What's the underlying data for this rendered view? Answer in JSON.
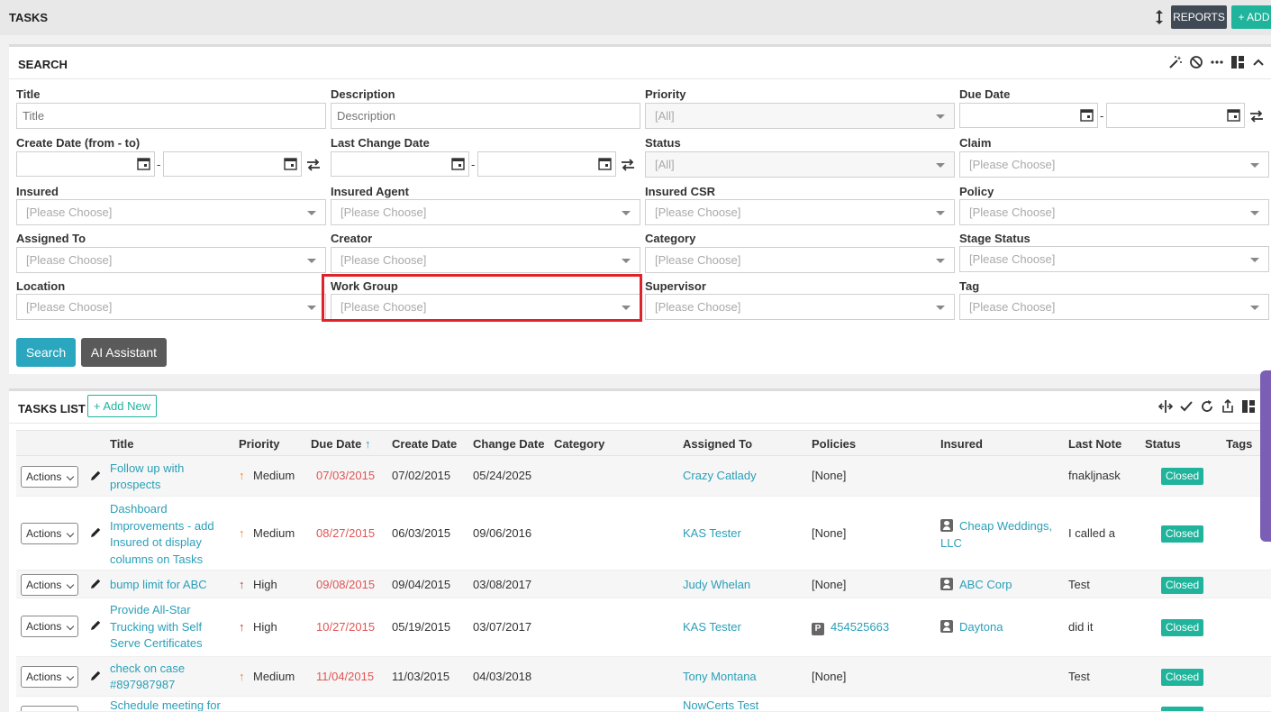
{
  "topbar": {
    "title": "TASKS",
    "reports_label": "REPORTS",
    "add_label": "+ ADD"
  },
  "search_panel": {
    "title": "SEARCH",
    "fields": {
      "title": {
        "label": "Title",
        "placeholder": "Title"
      },
      "description": {
        "label": "Description",
        "placeholder": "Description"
      },
      "priority": {
        "label": "Priority",
        "value": "[All]"
      },
      "due_date": {
        "label": "Due Date"
      },
      "create_date": {
        "label": "Create Date (from - to)"
      },
      "last_change_date": {
        "label": "Last Change Date"
      },
      "status": {
        "label": "Status",
        "value": "[All]"
      },
      "claim": {
        "label": "Claim",
        "value": "[Please Choose]"
      },
      "insured": {
        "label": "Insured",
        "value": "[Please Choose]"
      },
      "insured_agent": {
        "label": "Insured Agent",
        "value": "[Please Choose]"
      },
      "insured_csr": {
        "label": "Insured CSR",
        "value": "[Please Choose]"
      },
      "policy": {
        "label": "Policy",
        "value": "[Please Choose]"
      },
      "assigned_to": {
        "label": "Assigned To",
        "value": "[Please Choose]"
      },
      "creator": {
        "label": "Creator",
        "value": "[Please Choose]"
      },
      "category": {
        "label": "Category",
        "value": "[Please Choose]"
      },
      "stage_status": {
        "label": "Stage Status",
        "value": "[Please Choose]"
      },
      "location": {
        "label": "Location",
        "value": "[Please Choose]"
      },
      "work_group": {
        "label": "Work Group",
        "value": "[Please Choose]"
      },
      "supervisor": {
        "label": "Supervisor",
        "value": "[Please Choose]"
      },
      "tag": {
        "label": "Tag",
        "value": "[Please Choose]"
      }
    },
    "date_separator": "-",
    "search_label": "Search",
    "ai_label": "AI Assistant"
  },
  "tasks_list": {
    "title": "TASKS LIST",
    "add_new_label": "+ Add New",
    "columns": [
      "Title",
      "Priority",
      "Due Date",
      "Create Date",
      "Change Date",
      "Category",
      "Assigned To",
      "Policies",
      "Insured",
      "Last Note",
      "Status",
      "Tags"
    ],
    "sort_arrow": "↑",
    "actions_label": "Actions",
    "rows": [
      {
        "title": "Follow up with prospects",
        "priority": "Medium",
        "due": "07/03/2015",
        "created": "07/02/2015",
        "changed": "05/24/2025",
        "assigned": "Crazy Catlady",
        "policies": "[None]",
        "insured": "",
        "note": "fnakljnask",
        "status": "Closed"
      },
      {
        "title": "Dashboard Improvements - add Insured ot display columns on Tasks",
        "priority": "Medium",
        "due": "08/27/2015",
        "created": "06/03/2015",
        "changed": "09/06/2016",
        "assigned": "KAS Tester",
        "policies": "[None]",
        "insured": "Cheap Weddings, LLC",
        "note": "I called a",
        "status": "Closed"
      },
      {
        "title": "bump limit for ABC",
        "priority": "High",
        "due": "09/08/2015",
        "created": "09/04/2015",
        "changed": "03/08/2017",
        "assigned": "Judy Whelan",
        "policies": "[None]",
        "insured": "ABC Corp",
        "note": "Test",
        "status": "Closed"
      },
      {
        "title": "Provide All-Star Trucking with Self Serve Certificates",
        "priority": "High",
        "due": "10/27/2015",
        "created": "05/19/2015",
        "changed": "03/07/2017",
        "assigned": "KAS Tester",
        "policies": "454525663",
        "insured": "Daytona",
        "note": "did it",
        "status": "Closed"
      },
      {
        "title": "check on case #897987987",
        "priority": "Medium",
        "due": "11/04/2015",
        "created": "11/03/2015",
        "changed": "04/03/2018",
        "assigned": "Tony Montana",
        "policies": "[None]",
        "insured": "",
        "note": "Test",
        "status": "Closed"
      },
      {
        "title": "Schedule meeting for",
        "assigned": "NowCerts Test"
      }
    ]
  },
  "colors": {
    "accent": "#1fb49b",
    "link": "#2a9fb8",
    "highlight": "#e0232b",
    "overdue": "#e05555",
    "high_priority": "#c0392b",
    "medium_priority": "#f0872a"
  }
}
